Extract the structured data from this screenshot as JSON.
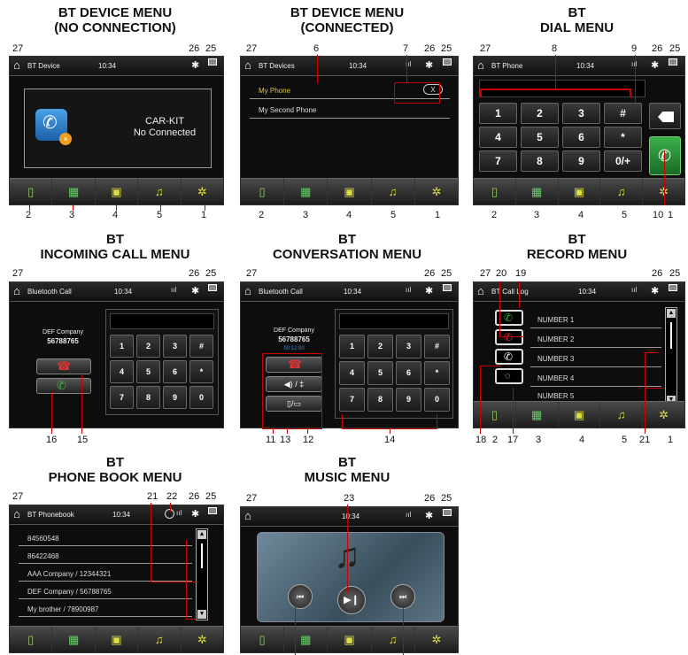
{
  "captions": {
    "p1": [
      "BT DEVICE MENU",
      "(NO CONNECTION)"
    ],
    "p2": [
      "BT DEVICE MENU",
      "(CONNECTED)"
    ],
    "p3": [
      "BT",
      "DIAL MENU"
    ],
    "p4": [
      "BT",
      "INCOMING CALL MENU"
    ],
    "p5": [
      "BT",
      "CONVERSATION MENU"
    ],
    "p6": [
      "BT",
      "RECORD MENU"
    ],
    "p7": [
      "BT",
      "PHONE BOOK MENU"
    ],
    "p8": [
      "BT",
      "MUSIC MENU"
    ]
  },
  "clock": "10:34",
  "titles": {
    "p1": "BT Device",
    "p2": "BT Devices",
    "p3": "BT Phone",
    "p4": "Bluetooth Call",
    "p5": "Bluetooth Call",
    "p6": "BT Call Log",
    "p7": "BT Phonebook"
  },
  "p1": {
    "line1": "CAR-KIT",
    "line2": "No Connected"
  },
  "p2": {
    "dev1": "My Phone",
    "dev2": "My Second Phone",
    "close": "X"
  },
  "keys": [
    "1",
    "2",
    "3",
    "#",
    "4",
    "5",
    "6",
    "*",
    "7",
    "8",
    "9",
    "0"
  ],
  "dial_keys": [
    "1",
    "2",
    "3",
    "#",
    "4",
    "5",
    "6",
    "*",
    "7",
    "8",
    "9",
    "0/+"
  ],
  "call": {
    "company": "DEF Company",
    "number": "56788765",
    "timer": "00:12:00"
  },
  "p5": {
    "vol_label": "◀) / ‡",
    "trans_label": "▯/▭"
  },
  "p6": {
    "items": [
      "NUMBER 1",
      "NUMBER 2",
      "NUMBER 3",
      "NUMBER 4",
      "NUMBER 5"
    ]
  },
  "p7": {
    "items": [
      "84560548",
      "86422468",
      "AAA Company / 12344321",
      "DEF Company / 56788765",
      "My brother / 78900987"
    ]
  },
  "icons": {
    "home": "home-icon",
    "bluetooth": "bluetooth-icon",
    "signal": "signal-icon",
    "antenna": "antenna-icon",
    "phone": "phone-icon",
    "dialpad": "dialpad-icon",
    "phonebook": "phonebook-icon",
    "music": "music-note-icon",
    "settings": "gear-icon",
    "backspace": "backspace-icon",
    "call": "call-icon",
    "hangup": "hangup-icon",
    "prev": "previous-track-icon",
    "next": "next-track-icon",
    "playpause": "play-pause-icon"
  },
  "colors": {
    "callout": "#cc0000",
    "screen": "#0d0d0d",
    "green": "#2e9b3c",
    "red": "#c0202a"
  },
  "callouts": {
    "p1": [
      "27",
      "26",
      "25",
      "2",
      "3",
      "4",
      "5",
      "1"
    ],
    "p2": [
      "27",
      "6",
      "7",
      "26",
      "25",
      "2",
      "3",
      "4",
      "5",
      "1"
    ],
    "p3": [
      "27",
      "8",
      "9",
      "26",
      "25",
      "2",
      "3",
      "4",
      "5",
      "10",
      "1"
    ],
    "p4": [
      "27",
      "26",
      "25",
      "16",
      "15"
    ],
    "p5": [
      "27",
      "26",
      "25",
      "11",
      "13",
      "12",
      "14"
    ],
    "p6": [
      "27",
      "20",
      "19",
      "26",
      "25",
      "18",
      "2",
      "17",
      "3",
      "4",
      "5",
      "21",
      "1"
    ],
    "p7": [
      "27",
      "21",
      "22",
      "26",
      "25"
    ],
    "p8": [
      "27",
      "23",
      "26",
      "25"
    ]
  }
}
